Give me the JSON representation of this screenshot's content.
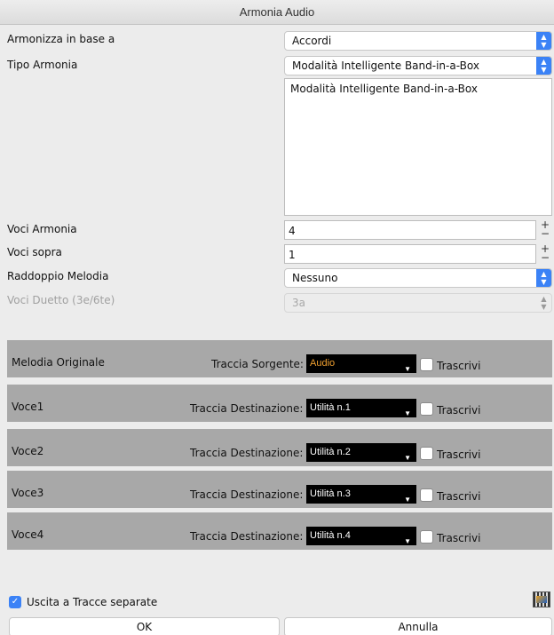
{
  "window": {
    "title": "Armonia Audio"
  },
  "form": {
    "harmonize_label": "Armonizza in base a",
    "harmonize_value": "Accordi",
    "type_label": "Tipo Armonia",
    "type_value": "Modalità Intelligente Band-in-a-Box",
    "type_description": "Modalità Intelligente Band-in-a-Box",
    "voices_label": "Voci Armonia",
    "voices_value": "4",
    "voices_above_label": "Voci sopra",
    "voices_above_value": "1",
    "doubling_label": "Raddoppio Melodia",
    "doubling_value": "Nessuno",
    "duet_label": "Voci Duetto (3e/6te)",
    "duet_value": "3a",
    "stepper_plus": "+",
    "stepper_minus": "−"
  },
  "tracks": [
    {
      "name": "Melodia Originale",
      "track_label": "Traccia Sorgente:",
      "track_value": "Audio",
      "transcribe_label": "Trascrivi"
    },
    {
      "name": "Voce1",
      "track_label": "Traccia Destinazione:",
      "track_value": "Utilità n.1",
      "transcribe_label": "Trascrivi"
    },
    {
      "name": "Voce2",
      "track_label": "Traccia Destinazione:",
      "track_value": "Utilità n.2",
      "transcribe_label": "Trascrivi"
    },
    {
      "name": "Voce3",
      "track_label": "Traccia Destinazione:",
      "track_value": "Utilità n.3",
      "transcribe_label": "Trascrivi"
    },
    {
      "name": "Voce4",
      "track_label": "Traccia Destinazione:",
      "track_value": "Utilità n.4",
      "transcribe_label": "Trascrivi"
    }
  ],
  "footer": {
    "separate_tracks_label": "Uscita a Tracce separate",
    "separate_tracks_checked": true,
    "ok_label": "OK",
    "cancel_label": "Annulla"
  },
  "icons": {
    "popup_arrows": "up-down-chevron-icon",
    "combo_arrow": "triangle-down-icon",
    "checkmark": "checkmark-icon",
    "fullscreen": "film-strip-icon"
  },
  "colors": {
    "accent": "#3b82f6",
    "band": "#a8a8a8",
    "combo_bg": "#000000",
    "source_text": "#f0a030"
  }
}
